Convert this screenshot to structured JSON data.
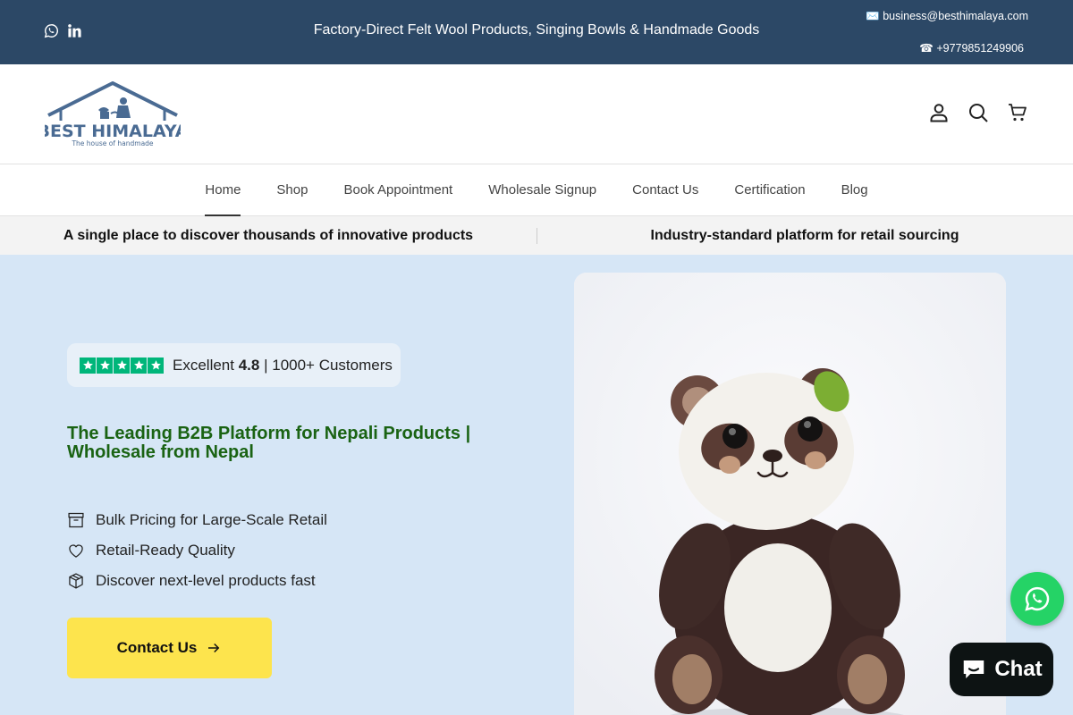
{
  "topbar": {
    "announcement": "Factory-Direct Felt Wool Products, Singing Bowls & Handmade Goods",
    "email": "✉️ business@besthimalaya.com",
    "phone": "☎ +9779851249906",
    "social_icons": [
      "whatsapp-icon",
      "linkedin-icon"
    ]
  },
  "brand": {
    "name": "BEST HIMALAYA",
    "tagline": "The house of handmade",
    "logo_color": "#4a6b93"
  },
  "header_icons": [
    "account-icon",
    "search-icon",
    "cart-icon"
  ],
  "nav": {
    "items": [
      {
        "label": "Home",
        "active": true
      },
      {
        "label": "Shop"
      },
      {
        "label": "Book Appointment"
      },
      {
        "label": "Wholesale Signup"
      },
      {
        "label": "Contact Us"
      },
      {
        "label": "Certification"
      },
      {
        "label": "Blog"
      }
    ]
  },
  "strip": {
    "left": "A single place to discover thousands of innovative products",
    "right": "Industry-standard platform for retail sourcing"
  },
  "hero": {
    "rating": {
      "stars": 5,
      "prefix": "Excellent",
      "score": "4.8",
      "suffix": "| 1000+ Customers",
      "star_color": "#00b67a"
    },
    "headline": "The Leading B2B Platform for Nepali Products | Wholesale from Nepal",
    "features": [
      {
        "icon": "box-icon",
        "text": "Bulk Pricing for Large-Scale Retail"
      },
      {
        "icon": "heart-icon",
        "text": "Retail-Ready Quality"
      },
      {
        "icon": "cube-icon",
        "text": "Discover next-level products fast"
      }
    ],
    "cta_label": "Contact Us",
    "image": "felt-panda"
  },
  "chat": {
    "label": "Chat"
  },
  "colors": {
    "topbar": "#2c4866",
    "hero_bg": "#d6e6f6",
    "headline": "#1a6313",
    "cta": "#fde44d",
    "whatsapp": "#25d366",
    "chat_bg": "#0d1313"
  }
}
